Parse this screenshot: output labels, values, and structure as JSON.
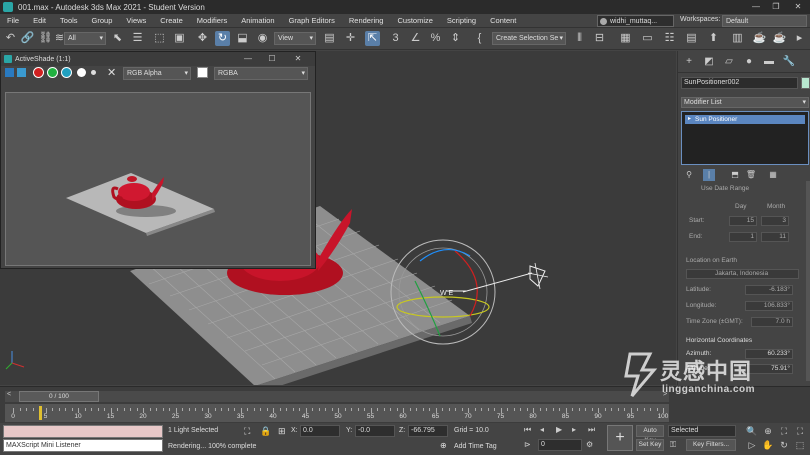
{
  "window": {
    "title": "001.max - Autodesk 3ds Max 2021 - Student Version",
    "minimize": "—",
    "restore": "❐",
    "close": "✕"
  },
  "menu": [
    "File",
    "Edit",
    "Tools",
    "Group",
    "Views",
    "Create",
    "Modifiers",
    "Animation",
    "Graph Editors",
    "Rendering",
    "Customize",
    "Scripting",
    "Content"
  ],
  "user": {
    "name": "widhi_muttaq..."
  },
  "workspace": {
    "label": "Workspaces:",
    "value": "Default"
  },
  "toolbar": {
    "filter": "All",
    "coord_system": "View",
    "selection_set": "Create Selection Se",
    "icons": [
      "undo-icon",
      "link-icon",
      "unlink-icon",
      "bind-space-warp-icon",
      "select-icon",
      "select-by-name-icon",
      "rect-region-icon",
      "window-crossing-icon",
      "move-icon",
      "rotate-icon",
      "scale-icon",
      "place-icon",
      "pivot-icon",
      "snap-icon",
      "angle-snap-icon",
      "percent-snap-icon",
      "spinner-snap-icon",
      "mirror-icon",
      "align-icon",
      "layer-icon",
      "ribbon-icon",
      "curve-editor-icon",
      "schematic-icon",
      "material-editor-icon",
      "render-setup-icon",
      "rendered-frame-icon",
      "render-icon"
    ]
  },
  "activeshade": {
    "title": "ActiveShade (1:1)",
    "channel": "RGB Alpha",
    "format": "RGBA",
    "minimize": "—",
    "maximize": "☐",
    "close": "✕"
  },
  "command_panel": {
    "object_name": "SunPositioner002",
    "object_color": "#b8e8d0",
    "modifier_list": "Modifier List",
    "stack_item": "Sun Positioner",
    "use_date_range": "Use Date Range",
    "day_label": "Day",
    "month_label": "Month",
    "start_label": "Start:",
    "start_day": "15",
    "start_month": "3",
    "end_label": "End:",
    "end_day": "1",
    "end_month": "11",
    "location_header": "Location on Earth",
    "location_value": "Jakarta, Indonesia",
    "latitude_label": "Latitude:",
    "latitude_value": "-6.183°",
    "longitude_label": "Longitude:",
    "longitude_value": "106.833°",
    "timezone_label": "Time Zone (±GMT):",
    "timezone_value": "7.0 h",
    "horizontal_header": "Horizontal Coordinates",
    "azimuth_label": "Azimuth:",
    "azimuth_value": "60.233°",
    "altitude_label": "Altitude:",
    "altitude_value": "75.91°"
  },
  "timeline": {
    "frame_display": "0 / 100",
    "prev": "<",
    "next": ">",
    "ticks": [
      0,
      5,
      10,
      15,
      20,
      25,
      30,
      35,
      40,
      45,
      50,
      55,
      60,
      65,
      70,
      75,
      80,
      85,
      90,
      95,
      100
    ]
  },
  "status": {
    "listener": "MAXScript Mini Listener",
    "selection": "1 Light Selected",
    "prompt": "Rendering... 100% complete",
    "x_label": "X:",
    "x_value": "0.0",
    "y_label": "Y:",
    "y_value": "-0.0",
    "z_label": "Z:",
    "z_value": "-66.795",
    "grid": "Grid = 10.0",
    "add_time_tag": "Add Time Tag",
    "auto_key": "Auto Key",
    "selected": "Selected",
    "set_key": "Set Key",
    "key_filters": "Key Filters...",
    "current_frame": "0"
  },
  "watermark": {
    "text": "灵感中国",
    "url": "lingganchina.com"
  }
}
